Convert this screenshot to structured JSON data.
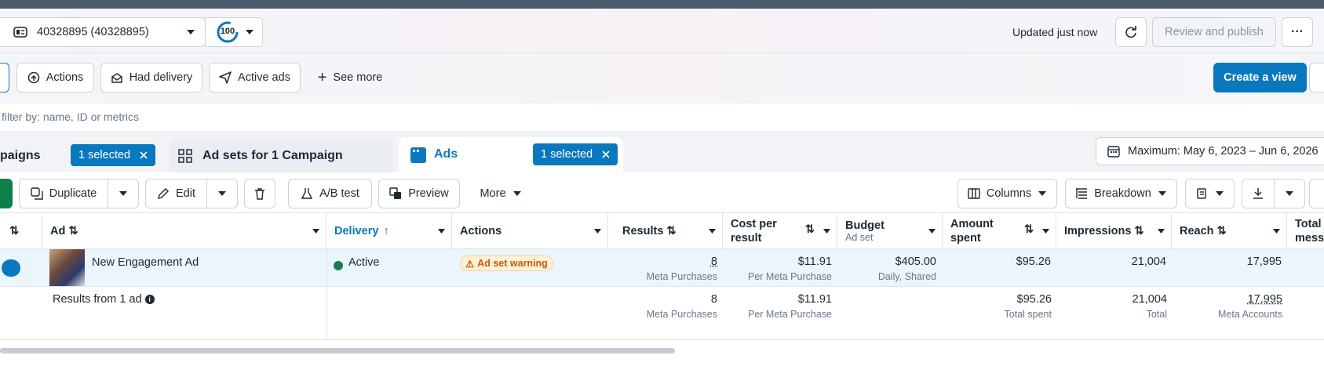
{
  "header": {
    "account_label": "40328895 (40328895)",
    "score": "100",
    "updated_text": "Updated just now",
    "review_publish": "Review and publish"
  },
  "filters": {
    "actions": "Actions",
    "had_delivery": "Had delivery",
    "active_ads": "Active ads",
    "see_more": "See more",
    "create_view": "Create a view"
  },
  "search": {
    "placeholder": "filter by: name, ID or metrics"
  },
  "tabs": {
    "campaigns_label": "paigns",
    "campaigns_selected": "1 selected",
    "adsets_label": "Ad sets for 1 Campaign",
    "ads_label": "Ads",
    "ads_selected": "1 selected"
  },
  "date_range": "Maximum: May 6, 2023 – Jun 6, 2026",
  "toolbar": {
    "duplicate": "Duplicate",
    "edit": "Edit",
    "ab_test": "A/B test",
    "preview": "Preview",
    "more": "More",
    "columns": "Columns",
    "breakdown": "Breakdown"
  },
  "columns": {
    "ad": "Ad",
    "delivery": "Delivery",
    "actions": "Actions",
    "results": "Results",
    "cost_per_result": "Cost per result",
    "budget": "Budget",
    "budget_sub": "Ad set",
    "amount_spent": "Amount spent",
    "impressions": "Impressions",
    "reach": "Reach",
    "total_messages": "Total messa"
  },
  "rows": [
    {
      "ad_name": "New Engagement Ad",
      "delivery": "Active",
      "actions": "Ad set warning",
      "results": "8",
      "results_sub": "Meta Purchases",
      "cost": "$11.91",
      "cost_sub": "Per Meta Purchase",
      "budget": "$405.00",
      "budget_sub": "Daily, Shared",
      "spent": "$95.26",
      "impressions": "21,004",
      "reach": "17,995"
    }
  ],
  "summary": {
    "label": "Results from 1 ad",
    "results": "8",
    "results_sub": "Meta Purchases",
    "cost": "$11.91",
    "cost_sub": "Per Meta Purchase",
    "spent": "$95.26",
    "spent_sub": "Total spent",
    "impressions": "21,004",
    "impressions_sub": "Total",
    "reach": "17,995",
    "reach_sub": "Meta Accounts"
  },
  "colors": {
    "primary": "#0a78be",
    "active_green": "#1f7a4d",
    "warning": "#c75b00"
  }
}
